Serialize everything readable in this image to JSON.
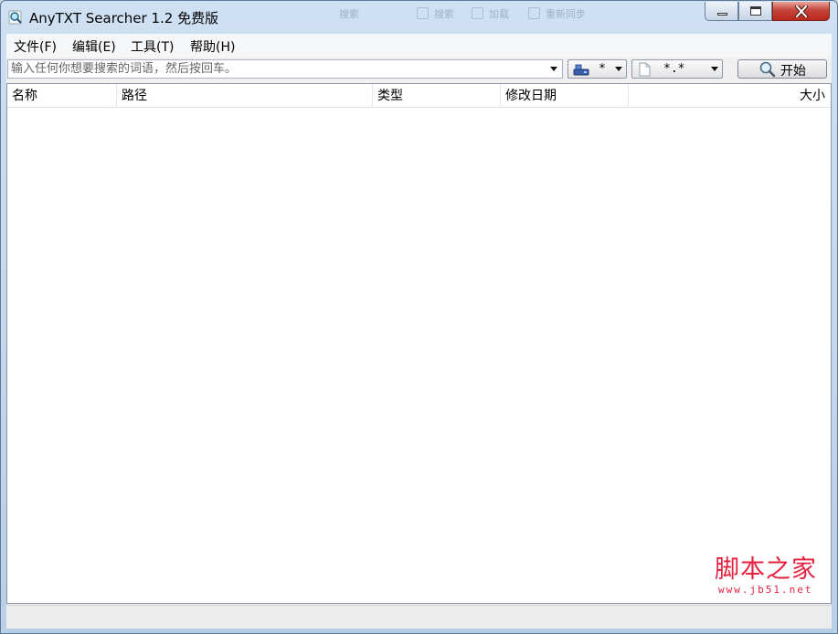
{
  "window": {
    "title": "AnyTXT Searcher 1.2 免费版",
    "ghost_labels": [
      "搜索",
      "搜索",
      "加载",
      "重新同步"
    ]
  },
  "menu": {
    "items": [
      "文件(F)",
      "编辑(E)",
      "工具(T)",
      "帮助(H)"
    ]
  },
  "toolbar": {
    "search_placeholder": "输入任何你想要搜索的词语，然后按回车。",
    "drive_value": "*",
    "type_value": "*.*",
    "start_label": "开始"
  },
  "results": {
    "columns": [
      "名称",
      "路径",
      "类型",
      "修改日期",
      "大小"
    ],
    "rows": []
  },
  "watermark": {
    "main": "脚本之家",
    "url": "www.jb51.net"
  },
  "colors": {
    "close_button": "#c6453a",
    "watermark": "#e3213f",
    "window_frame": "#b9cfe8"
  }
}
